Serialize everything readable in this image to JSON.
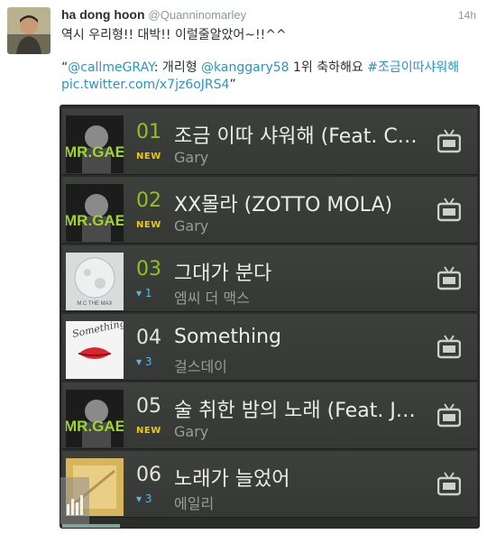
{
  "tweet": {
    "display_name": "ha dong hoon",
    "handle": "@Quanninomarley",
    "time": "14h",
    "text": "역시 우리형!! 대박!! 이럴줄알았어~!!^^",
    "quote_open": "“",
    "mention1": "@callmeGRAY",
    "quote_mid": ": 개리형 ",
    "mention2": "@kanggary58",
    "quote_mid2": " 1위 축하해요 ",
    "hashtag": "#조금이따샤워해",
    "link": "pic.twitter.com/x7jz6oJRS4",
    "quote_close": "”"
  },
  "chart": {
    "rows": [
      {
        "rank": "01",
        "title": "조금 이따 샤워해 (Feat. C…",
        "status": "NEW",
        "artist": "Gary",
        "album_text": "MR.GAE",
        "highlight": true
      },
      {
        "rank": "02",
        "title": "XX몰라 (ZOTTO MOLA)",
        "status": "NEW",
        "artist": "Gary",
        "album_text": "MR.GAE",
        "highlight": true
      },
      {
        "rank": "03",
        "title": "그대가 분다",
        "status": "▾ 1",
        "artist": "엠씨 더 맥스",
        "album_text": "M.C THE MAX",
        "highlight": true
      },
      {
        "rank": "04",
        "title": "Something",
        "status": "▾ 3",
        "artist": "걸스데이",
        "album_text": "Something",
        "highlight": false
      },
      {
        "rank": "05",
        "title": "술 취한 밤의 노래 (Feat. J…",
        "status": "NEW",
        "artist": "Gary",
        "album_text": "MR.GAE",
        "highlight": false
      },
      {
        "rank": "06",
        "title": "노래가 늘었어",
        "status": "▾ 3",
        "artist": "에일리",
        "album_text": "",
        "highlight": false
      }
    ]
  },
  "colors": {
    "accent_green": "#8fc31f",
    "new_badge": "#f5c800",
    "move_blue": "#5fb6e0",
    "link_blue": "#2a94c9"
  },
  "icons": {
    "row_action": "tv-icon",
    "overlay": "equalizer-icon"
  }
}
